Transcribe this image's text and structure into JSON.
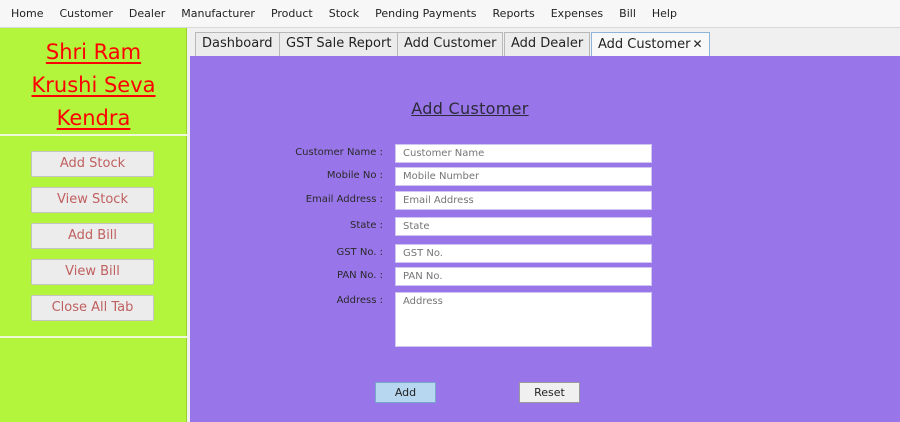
{
  "menu": [
    "Home",
    "Customer",
    "Dealer",
    "Manufacturer",
    "Product",
    "Stock",
    "Pending Payments",
    "Reports",
    "Expenses",
    "Bill",
    "Help"
  ],
  "sidebar": {
    "brand_lines": [
      "Shri Ram",
      "Krushi Seva",
      "Kendra"
    ],
    "buttons": [
      "Add Stock",
      "View Stock",
      "Add Bill",
      "View Bill",
      "Close All Tab"
    ]
  },
  "tabs": [
    {
      "label": "Dashboard"
    },
    {
      "label": "GST Sale Report"
    },
    {
      "label": "Add Customer"
    },
    {
      "label": "Add Dealer"
    },
    {
      "label": "Add Customer",
      "close": "✕",
      "active": true
    }
  ],
  "form": {
    "title": "Add Customer",
    "fields": [
      {
        "label": "Customer Name :",
        "placeholder": "Customer Name"
      },
      {
        "label": "Mobile No :",
        "placeholder": "Mobile Number"
      },
      {
        "label": "Email Address :",
        "placeholder": "Email Address"
      },
      {
        "label": "State :",
        "placeholder": "State"
      },
      {
        "label": "GST No. :",
        "placeholder": "GST No."
      },
      {
        "label": "PAN No. :",
        "placeholder": "PAN No."
      },
      {
        "label": "Address :",
        "placeholder": "Address"
      }
    ],
    "add_label": "Add",
    "reset_label": "Reset"
  },
  "colors": {
    "sidebar_bg": "#b2f53c",
    "panel_bg": "#9875e8",
    "brand_text": "#ff0000"
  }
}
